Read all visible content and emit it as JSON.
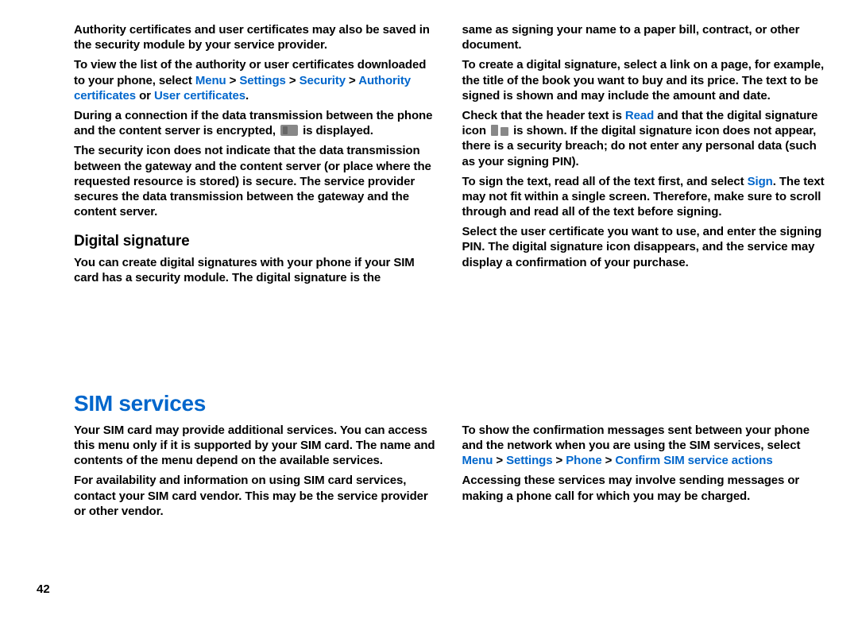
{
  "page_number": "42",
  "col1": {
    "p1": "Authority certificates and user certificates may also be saved in the security module by your service provider.",
    "p2a": "To view the list of the authority or user certificates downloaded to your phone, select ",
    "p2_menu": "Menu",
    "p2_gt1": " > ",
    "p2_settings": "Settings",
    "p2_gt2": " > ",
    "p2_security": "Security",
    "p2_gt3": " > ",
    "p2_auth": "Authority certificates",
    "p2_or": " or ",
    "p2_user": "User certificates",
    "p2_dot": ".",
    "p3a": "During a connection if the data transmission between the phone and the content server is encrypted, ",
    "p3b": " is displayed.",
    "p4": "The security icon does not indicate that the data transmission between the gateway and the content server (or place where the requested resource is stored) is secure. The service provider secures the data transmission between the gateway and the content server.",
    "h2": "Digital signature",
    "p5": "You can create digital signatures with your phone if your SIM card has a security module. The digital signature is the"
  },
  "col2": {
    "p1": "same as signing your name to a paper bill, contract, or other document.",
    "p2": "To create a digital signature, select a link on a page, for example, the title of the book you want to buy and its price. The text to be signed is shown and may include the amount and date.",
    "p3a": "Check that the header text is ",
    "p3_read": "Read",
    "p3b": " and that the digital signature icon ",
    "p3c": " is shown. If the digital signature icon does not appear, there is a security breach; do not enter any personal data (such as your signing PIN).",
    "p4a": "To sign the text, read all of the text first, and select ",
    "p4_sign": "Sign",
    "p4b": ". The text may not fit within a single screen. Therefore, make sure to scroll through and read all of the text before signing.",
    "p5": "Select the user certificate you want to use, and enter the signing PIN. The digital signature icon disappears, and the service may display a confirmation of your purchase."
  },
  "section2": {
    "h1": "SIM services",
    "left": {
      "p1": "Your SIM card may provide additional services. You can access this menu only if it is supported by your SIM card. The name and contents of the menu depend on the available services.",
      "p2": "For availability and information on using SIM card services, contact your SIM card vendor. This may be the service provider or other vendor."
    },
    "right": {
      "p1a": "To show the confirmation messages sent between your phone and the network when you are using the SIM services, select ",
      "p1_menu": "Menu",
      "p1_gt1": " > ",
      "p1_settings": "Settings",
      "p1_gt2": " > ",
      "p1_phone": "Phone",
      "p1_gt3": " > ",
      "p1_confirm": "Confirm SIM service actions",
      "p2": "Accessing these services may involve sending messages or making a phone call for which you may be charged."
    }
  }
}
